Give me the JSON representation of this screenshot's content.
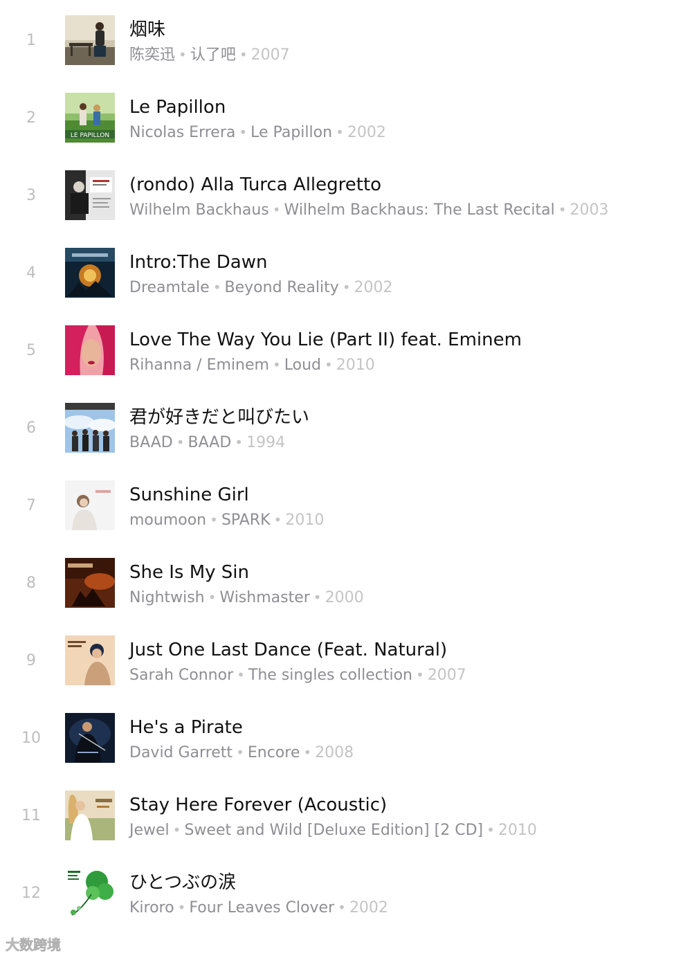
{
  "songs": [
    {
      "index": "1",
      "title": "烟味",
      "artist": "陈奕迅",
      "album": "认了吧",
      "year": "2007",
      "art": "bench-icon",
      "colors": [
        "#5d5548",
        "#bfb39a"
      ]
    },
    {
      "index": "2",
      "title": "Le Papillon",
      "artist": "Nicolas Errera",
      "album": "Le Papillon",
      "year": "2002",
      "art": "field-icon",
      "colors": [
        "#5a8a3a",
        "#1e4d2a"
      ],
      "art_text": "LE PAPILLON"
    },
    {
      "index": "3",
      "title": "(rondo) Alla Turca Allegretto",
      "artist": "Wilhelm Backhaus",
      "album": "Wilhelm Backhaus: The Last Recital",
      "year": "2003",
      "art": "pianist-icon",
      "colors": [
        "#d8d8d8",
        "#2a2a2a"
      ]
    },
    {
      "index": "4",
      "title": "Intro:The Dawn",
      "artist": "Dreamtale",
      "album": "Beyond Reality",
      "year": "2002",
      "art": "fantasy-icon",
      "colors": [
        "#0e2233",
        "#c77a22"
      ]
    },
    {
      "index": "5",
      "title": "Love The Way You Lie (Part II) feat. Eminem",
      "artist": "Rihanna / Eminem",
      "album": "Loud",
      "year": "2010",
      "art": "portrait-icon",
      "colors": [
        "#d4205c",
        "#f1a0a8"
      ]
    },
    {
      "index": "6",
      "title": "君が好きだと叫びたい",
      "artist": "BAAD",
      "album": "BAAD",
      "year": "1994",
      "art": "band-icon",
      "colors": [
        "#9ec4e8",
        "#2b2b2b"
      ]
    },
    {
      "index": "7",
      "title": "Sunshine Girl",
      "artist": "moumoon",
      "album": "SPARK",
      "year": "2010",
      "art": "portrait-light-icon",
      "colors": [
        "#f4f4f4",
        "#c9b7a6"
      ]
    },
    {
      "index": "8",
      "title": "She Is My Sin",
      "artist": "Nightwish",
      "album": "Wishmaster",
      "year": "2000",
      "art": "dark-fantasy-icon",
      "colors": [
        "#3a1608",
        "#b04a18"
      ]
    },
    {
      "index": "9",
      "title": "Just One Last Dance (Feat. Natural)",
      "artist": "Sarah Connor",
      "album": "The singles collection",
      "year": "2007",
      "art": "singer-icon",
      "colors": [
        "#f2d6b8",
        "#c9a07a"
      ]
    },
    {
      "index": "10",
      "title": "He's a Pirate",
      "artist": "David Garrett",
      "album": "Encore",
      "year": "2008",
      "art": "violinist-icon",
      "colors": [
        "#0f1a2c",
        "#5577aa"
      ]
    },
    {
      "index": "11",
      "title": "Stay Here Forever (Acoustic)",
      "artist": "Jewel",
      "album": "Sweet and Wild [Deluxe Edition] [2 CD]",
      "year": "2010",
      "art": "jewel-icon",
      "colors": [
        "#e9dcc2",
        "#8a6f3d"
      ]
    },
    {
      "index": "12",
      "title": "ひとつぶの涙",
      "artist": "Kiroro",
      "album": "Four Leaves Clover",
      "year": "2002",
      "art": "clover-icon",
      "colors": [
        "#ffffff",
        "#2f9b3a"
      ]
    }
  ],
  "watermark": "大数跨境"
}
